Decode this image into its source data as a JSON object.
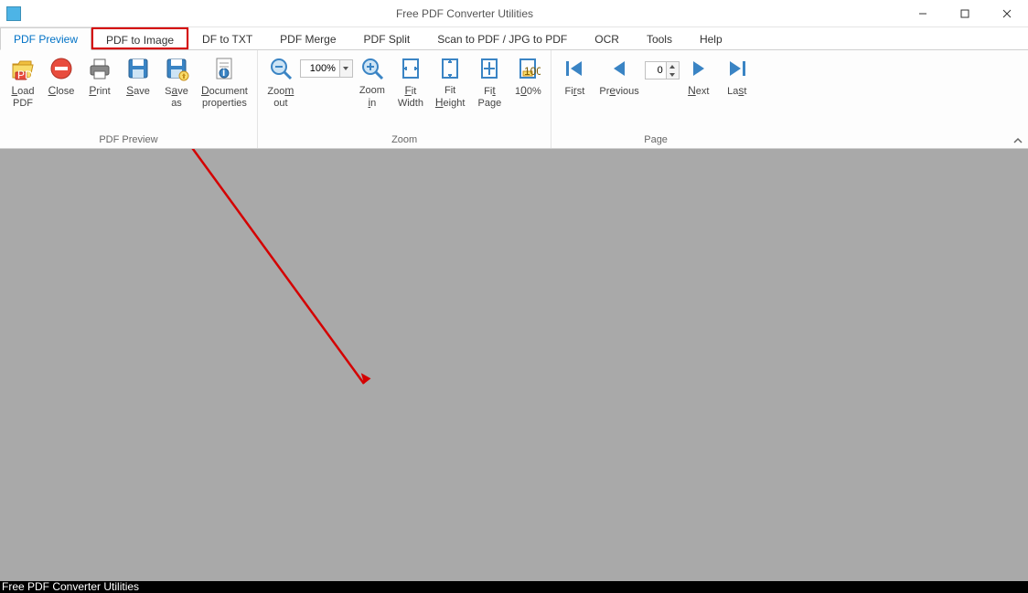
{
  "window": {
    "title": "Free PDF Converter Utilities"
  },
  "tabs": [
    {
      "id": "preview",
      "label": "PDF Preview"
    },
    {
      "id": "image",
      "label": "PDF to Image"
    },
    {
      "id": "txt",
      "label": "DF to TXT"
    },
    {
      "id": "merge",
      "label": "PDF Merge"
    },
    {
      "id": "split",
      "label": "PDF Split"
    },
    {
      "id": "scan",
      "label": "Scan to PDF / JPG to PDF"
    },
    {
      "id": "ocr",
      "label": "OCR"
    },
    {
      "id": "tools",
      "label": "Tools"
    },
    {
      "id": "help",
      "label": "Help"
    }
  ],
  "groups": {
    "pdfPreview": {
      "label": "PDF Preview",
      "buttons": {
        "load": "Load PDF",
        "close": "Close",
        "print": "Print",
        "save": "Save",
        "saveas": "Save as",
        "docprops": "Document properties"
      }
    },
    "zoom": {
      "label": "Zoom",
      "buttons": {
        "out": "Zoom out",
        "in": "Zoom in",
        "fitw": "Fit Width",
        "fith": "Fit Height",
        "fitp": "Fit Page",
        "hundred": "100%"
      },
      "value": "100%"
    },
    "page": {
      "label": "Page",
      "buttons": {
        "first": "First",
        "prev": "Previous",
        "next": "Next",
        "last": "Last"
      },
      "value": "0"
    }
  },
  "statusbar": "Free PDF Converter Utilities"
}
